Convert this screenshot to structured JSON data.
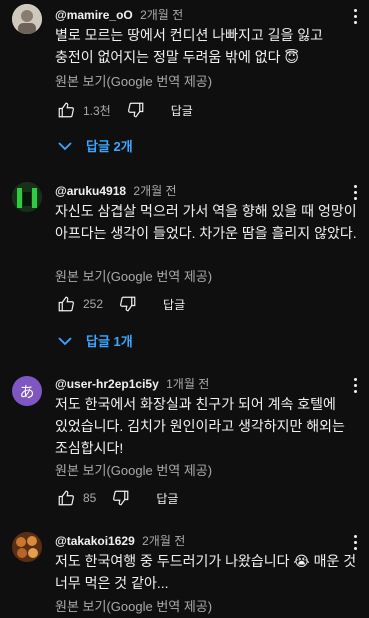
{
  "comments": [
    {
      "handle": "@mamire_oO",
      "time": "2개월 전",
      "text": "별로 모르는 땅에서 컨디션 나빠지고 길을 잃고 충전이 없어지는 정말 두려움 밖에 없다 😇",
      "translate_label": "원본 보기(Google 번역 제공)",
      "likes": "1.3천",
      "reply_label": "답글",
      "replies_label": "답글 2개",
      "avatar_icon": "user-avatar-photo"
    },
    {
      "handle": "@aruku4918",
      "time": "2개월 전",
      "text": "자신도 삼겹살 먹으러 가서 역을 향해 있을 때 엉망이 아프다는 생각이 들었다. 차가운 땀을 흘리지 않았다.",
      "translate_label": "원본 보기(Google 번역 제공)",
      "likes": "252",
      "reply_label": "답글",
      "replies_label": "답글 1개",
      "avatar_icon": "user-avatar-photo"
    },
    {
      "handle": "@user-hr2ep1ci5y",
      "time": "1개월 전",
      "text": "저도 한국에서 화장실과 친구가 되어 계속 호텔에 있었습니다. 김치가 원인이라고 생각하지만 해외는 조심합시다!",
      "translate_label": "원본 보기(Google 번역 제공)",
      "likes": "85",
      "reply_label": "답글",
      "avatar_letter": "あ",
      "avatar_color": "#7e57c2"
    },
    {
      "handle": "@takakoi1629",
      "time": "2개월 전",
      "text": "저도 한국여행 중 두드러기가 나왔습니다 😭 매운 것 너무 먹은 것 같아...",
      "translate_label": "원본 보기(Google 번역 제공)",
      "avatar_icon": "user-avatar-photo"
    }
  ]
}
